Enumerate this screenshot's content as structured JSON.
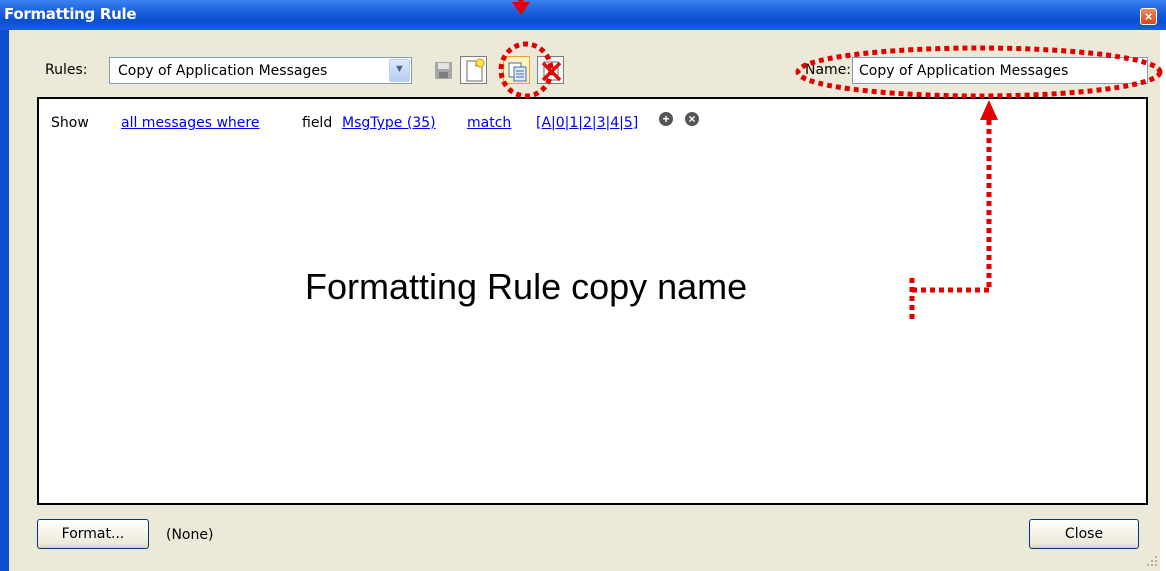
{
  "window": {
    "title": "Formatting Rule",
    "close_glyph": "×"
  },
  "toolbar": {
    "rules_label": "Rules:",
    "rules_selected": "Copy of Application Messages",
    "name_label": "Name:",
    "name_value": "Copy of Application Messages",
    "icons": [
      "save-icon",
      "new-rule-icon",
      "copy-rule-icon",
      "delete-rule-icon"
    ]
  },
  "rule": {
    "show": "Show",
    "scope": "all messages where",
    "field_word": "field",
    "field_name": "MsgType (35)",
    "operator": "match",
    "pattern": "[A|0|1|2|3|4|5]"
  },
  "annotation": {
    "text": "Formatting Rule copy name",
    "color": "#e00000"
  },
  "footer": {
    "format_button": "Format...",
    "format_value": "(None)",
    "close_button": "Close"
  }
}
